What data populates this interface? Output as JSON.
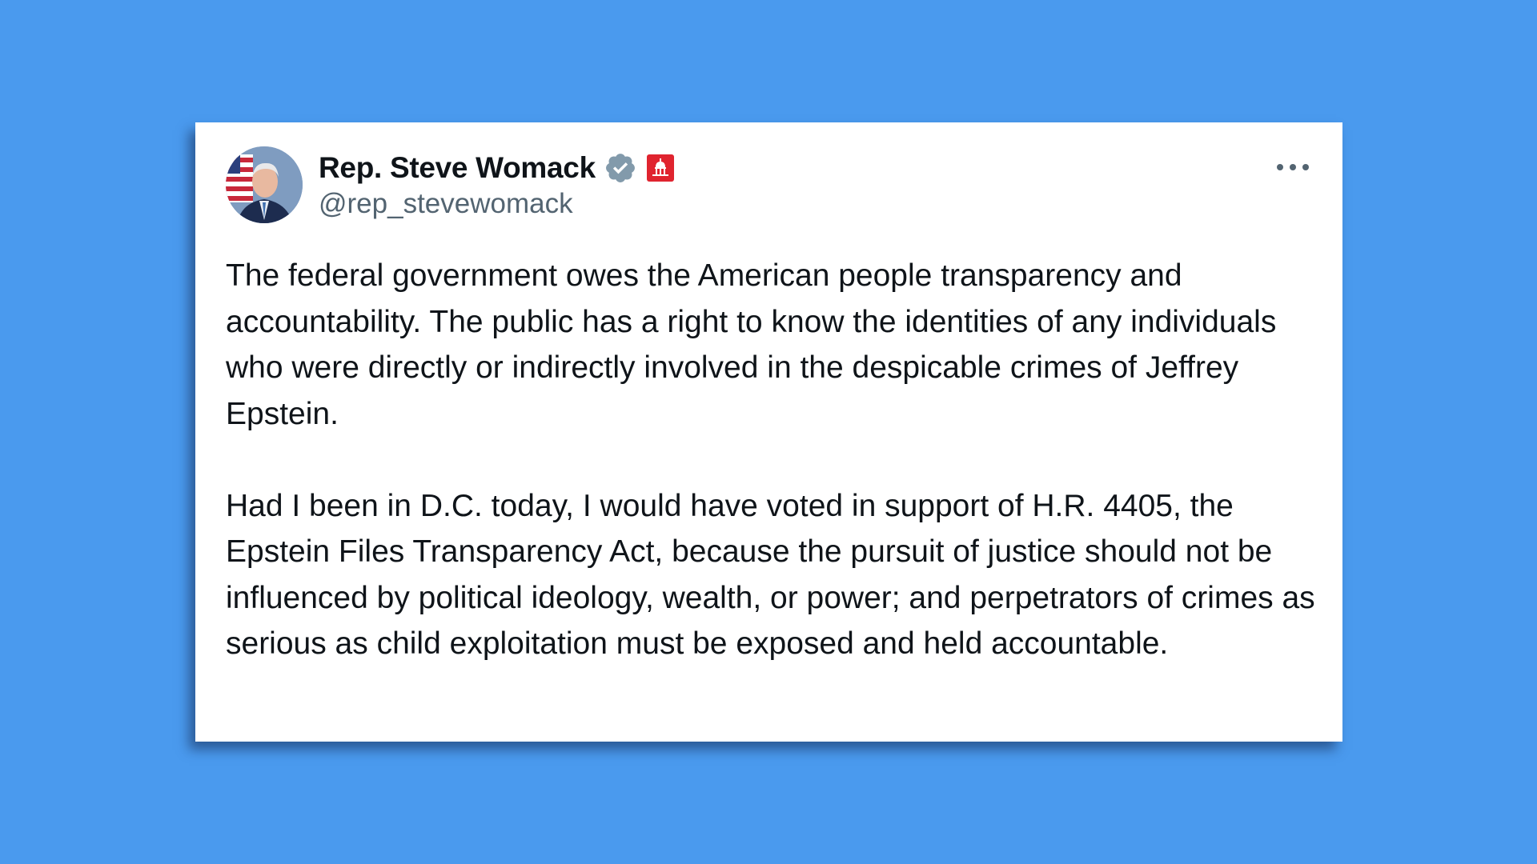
{
  "tweet": {
    "author": {
      "name": "Rep. Steve Womack",
      "handle": "@rep_stevewomack",
      "verified_icon": "verified-badge-icon",
      "affiliation_icon": "us-capitol-badge-icon",
      "avatar": "profile-photo"
    },
    "more_icon": "more-options-icon",
    "paragraphs": [
      "The federal government owes the American people transparency and accountability. The public has a right to know the identities of any individuals who were directly or indirectly involved in the despicable crimes of Jeffrey Epstein.",
      "Had I been in D.C. today, I would have voted in support of H.R. 4405, the Epstein Files Transparency Act, because the pursuit of justice should not be influenced by political ideology, wealth, or power; and perpetrators of crimes as serious as child exploitation must be exposed and held accountable."
    ]
  },
  "colors": {
    "background": "#4a9aee",
    "card": "#ffffff",
    "text": "#0f1419",
    "muted": "#536471",
    "verified": "#829aab",
    "gov_badge": "#e0242f"
  }
}
